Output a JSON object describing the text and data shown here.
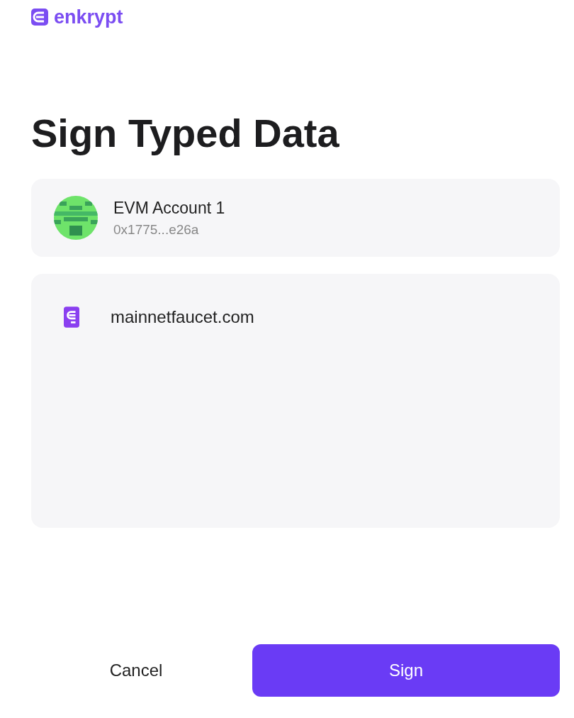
{
  "logo": {
    "text": "enkrypt"
  },
  "title": "Sign Typed Data",
  "account": {
    "name": "EVM Account 1",
    "address": "0x1775...e26a"
  },
  "site": {
    "domain": "mainnetfaucet.com"
  },
  "buttons": [
    {
      "label": "Cancel",
      "kind": "secondary"
    },
    {
      "label": "Sign",
      "kind": "primary"
    }
  ]
}
